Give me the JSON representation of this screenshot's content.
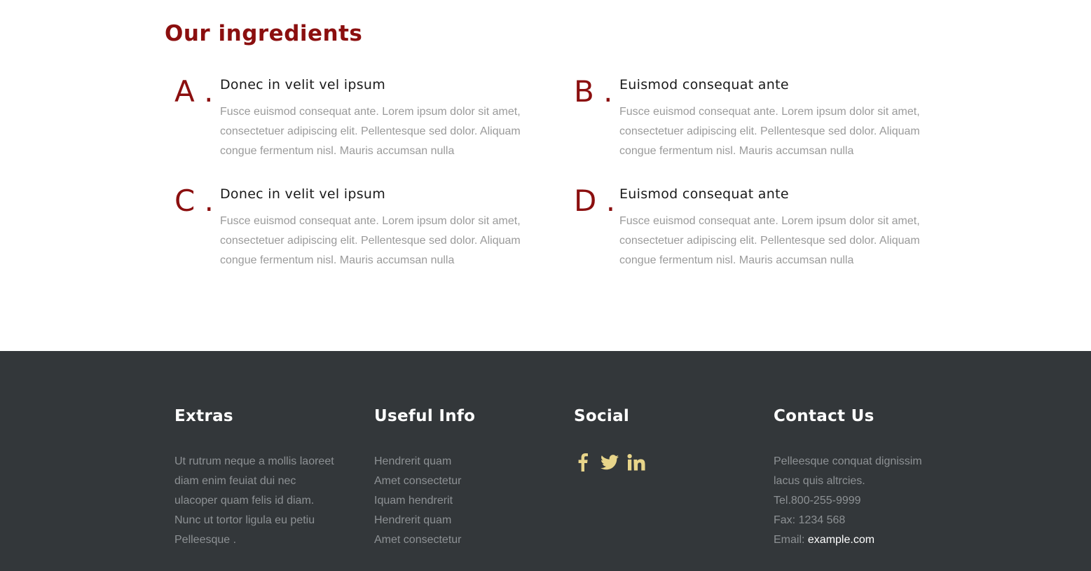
{
  "ingredients": {
    "title": "Our ingredients",
    "items": [
      {
        "letter": "A .",
        "heading": "Donec in velit vel ipsum",
        "text": "Fusce euismod consequat ante. Lorem ipsum dolor sit amet, consectetuer adipiscing elit. Pellentesque sed dolor. Aliquam congue fermentum nisl. Mauris accumsan nulla"
      },
      {
        "letter": "B .",
        "heading": "Euismod consequat ante",
        "text": "Fusce euismod consequat ante. Lorem ipsum dolor sit amet, consectetuer adipiscing elit. Pellentesque sed dolor. Aliquam congue fermentum nisl. Mauris accumsan nulla"
      },
      {
        "letter": "C .",
        "heading": "Donec in velit vel ipsum",
        "text": "Fusce euismod consequat ante. Lorem ipsum dolor sit amet, consectetuer adipiscing elit. Pellentesque sed dolor. Aliquam congue fermentum nisl. Mauris accumsan nulla"
      },
      {
        "letter": "D .",
        "heading": "Euismod consequat ante",
        "text": "Fusce euismod consequat ante. Lorem ipsum dolor sit amet, consectetuer adipiscing elit. Pellentesque sed dolor. Aliquam congue fermentum nisl. Mauris accumsan nulla"
      }
    ]
  },
  "footer": {
    "extras": {
      "title": "Extras",
      "lines": [
        "Ut rutrum neque a mollis laoreet",
        "diam enim feuiat dui nec",
        "ulacoper quam felis id diam.",
        "Nunc ut tortor ligula eu petiu",
        "Pelleesque ."
      ]
    },
    "useful_info": {
      "title": "Useful Info",
      "links": [
        "Hendrerit quam",
        "Amet consectetur",
        "Iquam hendrerit",
        "Hendrerit quam",
        "Amet consectetur"
      ]
    },
    "social": {
      "title": "Social",
      "icons": [
        "facebook-icon",
        "twitter-icon",
        "linkedin-icon"
      ],
      "icon_color": "#e8d58a"
    },
    "contact": {
      "title": "Contact Us",
      "lines": [
        "Pelleesque conquat dignissim",
        "lacus quis altrcies.",
        "Tel.800-255-9999",
        "Fax: 1234 568"
      ],
      "email_label": "Email: ",
      "email_link": "example.com"
    }
  },
  "colors": {
    "accent": "#8b0f0f",
    "footer_bg": "#33373a",
    "muted_text": "#8d9194",
    "body_text": "#9a9a9a"
  }
}
